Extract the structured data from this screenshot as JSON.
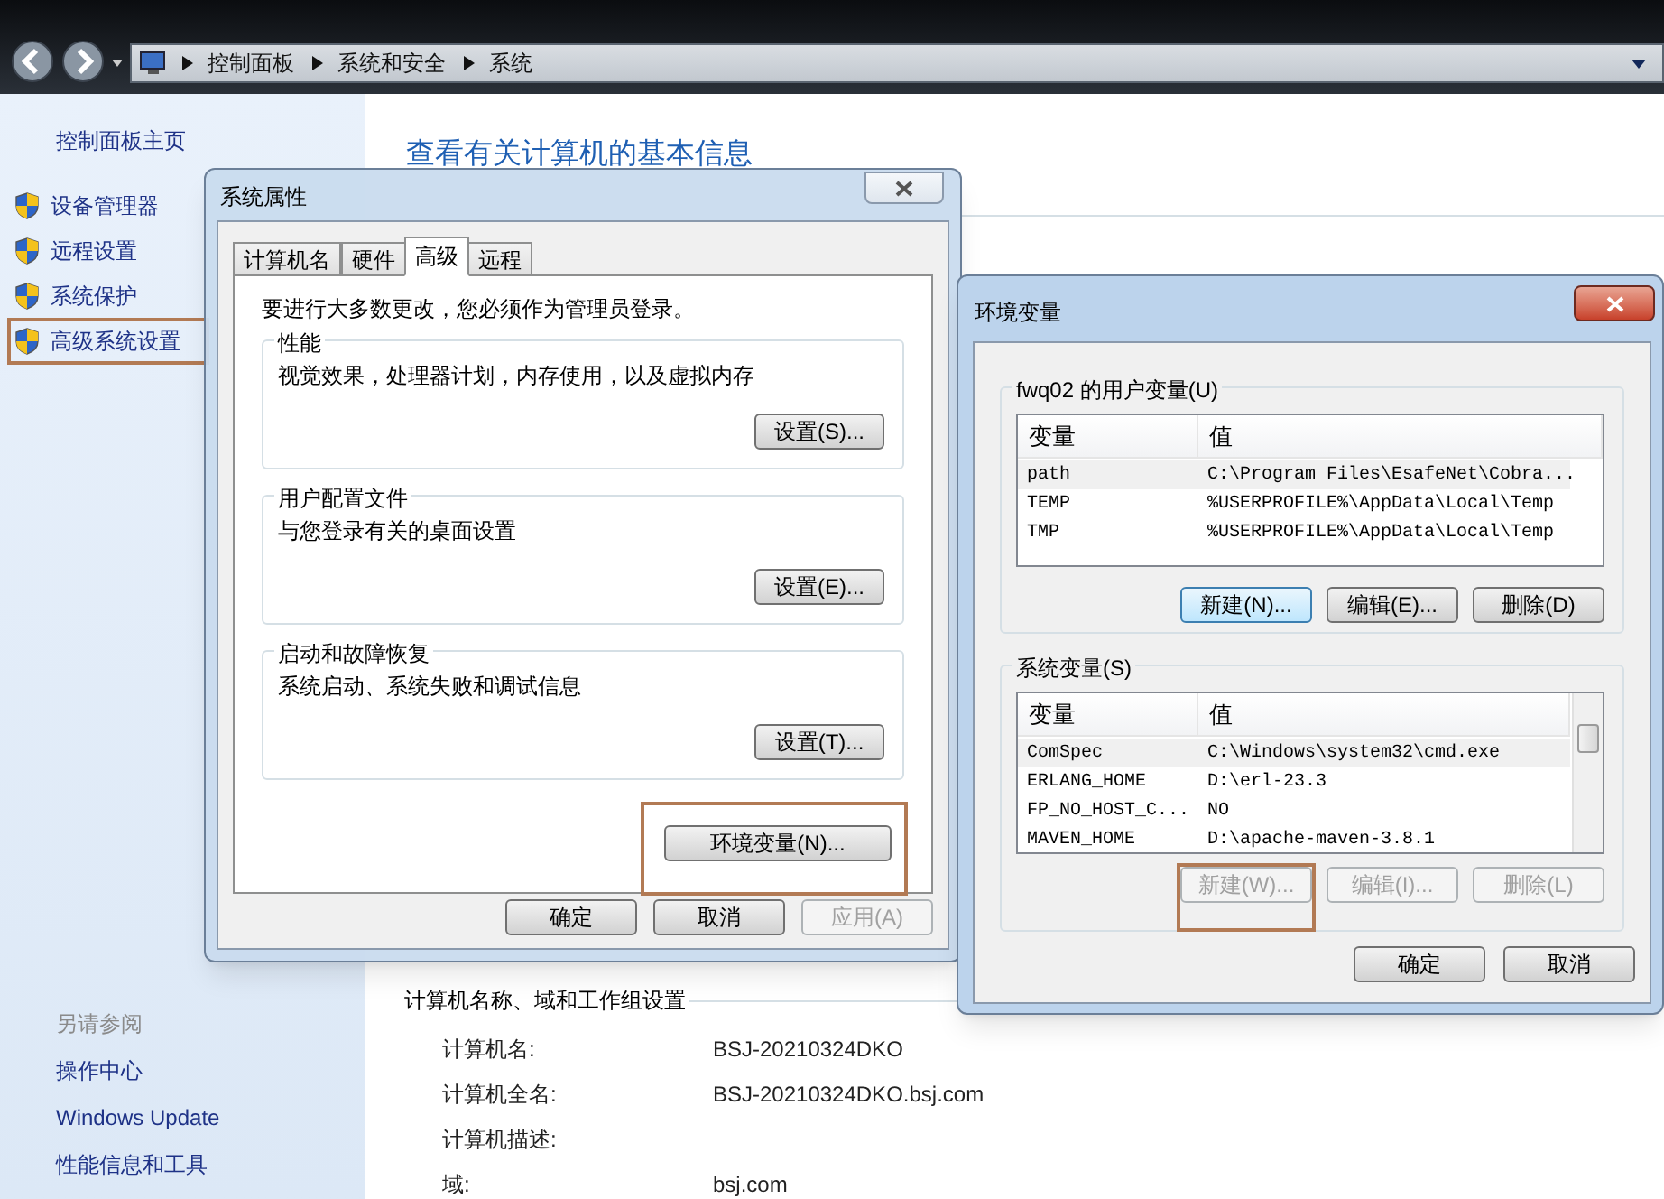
{
  "address_bar": {
    "crumbs": [
      "控制面板",
      "系统和安全",
      "系统"
    ]
  },
  "sidebar": {
    "home": "控制面板主页",
    "items": [
      {
        "label": "设备管理器",
        "highlighted": false
      },
      {
        "label": "远程设置",
        "highlighted": false
      },
      {
        "label": "系统保护",
        "highlighted": false
      },
      {
        "label": "高级系统设置",
        "highlighted": true
      }
    ],
    "see_also_title": "另请参阅",
    "see_also": [
      "操作中心",
      "Windows Update",
      "性能信息和工具"
    ]
  },
  "main": {
    "title": "查看有关计算机的基本信息",
    "section": "计算机名称、域和工作组设置",
    "fields": [
      {
        "label": "计算机名:",
        "value": "BSJ-20210324DKO"
      },
      {
        "label": "计算机全名:",
        "value": "BSJ-20210324DKO.bsj.com"
      },
      {
        "label": "计算机描述:"
      },
      {
        "label": "域:",
        "value": "bsj.com"
      }
    ]
  },
  "system_properties": {
    "title": "系统属性",
    "tabs": [
      {
        "label": "计算机名",
        "selected": false
      },
      {
        "label": "硬件",
        "selected": false
      },
      {
        "label": "高级",
        "selected": true
      },
      {
        "label": "远程",
        "selected": false
      }
    ],
    "notice": "要进行大多数更改，您必须作为管理员登录。",
    "groups": [
      {
        "title": "性能",
        "description": "视觉效果，处理器计划，内存使用，以及虚拟内存",
        "button": "设置(S)..."
      },
      {
        "title": "用户配置文件",
        "description": "与您登录有关的桌面设置",
        "button": "设置(E)..."
      },
      {
        "title": "启动和故障恢复",
        "description": "系统启动、系统失败和调试信息",
        "button": "设置(T)..."
      }
    ],
    "env_button": {
      "label": "环境变量(N)...",
      "highlighted": true
    },
    "buttons": [
      {
        "label": "确定",
        "disabled": false
      },
      {
        "label": "取消",
        "disabled": false
      },
      {
        "label": "应用(A)",
        "disabled": true
      }
    ]
  },
  "env_vars": {
    "title": "环境变量",
    "user_group": {
      "title": "fwq02 的用户变量(U)",
      "columns": [
        "变量",
        "值"
      ],
      "rows": [
        {
          "name": "path",
          "value": "C:\\Program Files\\EsafeNet\\Cobra...",
          "selected": true
        },
        {
          "name": "TEMP",
          "value": "%USERPROFILE%\\AppData\\Local\\Temp",
          "selected": false
        },
        {
          "name": "TMP",
          "value": "%USERPROFILE%\\AppData\\Local\\Temp",
          "selected": false
        }
      ],
      "buttons": [
        {
          "label": "新建(N)...",
          "disabled": false,
          "focused": true,
          "highlighted": false
        },
        {
          "label": "编辑(E)...",
          "disabled": false,
          "focused": false,
          "highlighted": false
        },
        {
          "label": "删除(D)",
          "disabled": false,
          "focused": false,
          "highlighted": false
        }
      ]
    },
    "system_group": {
      "title": "系统变量(S)",
      "columns": [
        "变量",
        "值"
      ],
      "rows": [
        {
          "name": "ComSpec",
          "value": "C:\\Windows\\system32\\cmd.exe",
          "selected": true
        },
        {
          "name": "ERLANG_HOME",
          "value": "D:\\erl-23.3",
          "selected": false
        },
        {
          "name": "FP_NO_HOST_C...",
          "value": "NO",
          "selected": false
        },
        {
          "name": "MAVEN_HOME",
          "value": "D:\\apache-maven-3.8.1",
          "selected": false
        }
      ],
      "buttons": [
        {
          "label": "新建(W)...",
          "disabled": true,
          "highlighted": true
        },
        {
          "label": "编辑(I)...",
          "disabled": true,
          "highlighted": false
        },
        {
          "label": "删除(L)",
          "disabled": true,
          "highlighted": false
        }
      ]
    },
    "buttons": [
      {
        "label": "确定",
        "disabled": false
      },
      {
        "label": "取消",
        "disabled": false
      }
    ]
  }
}
